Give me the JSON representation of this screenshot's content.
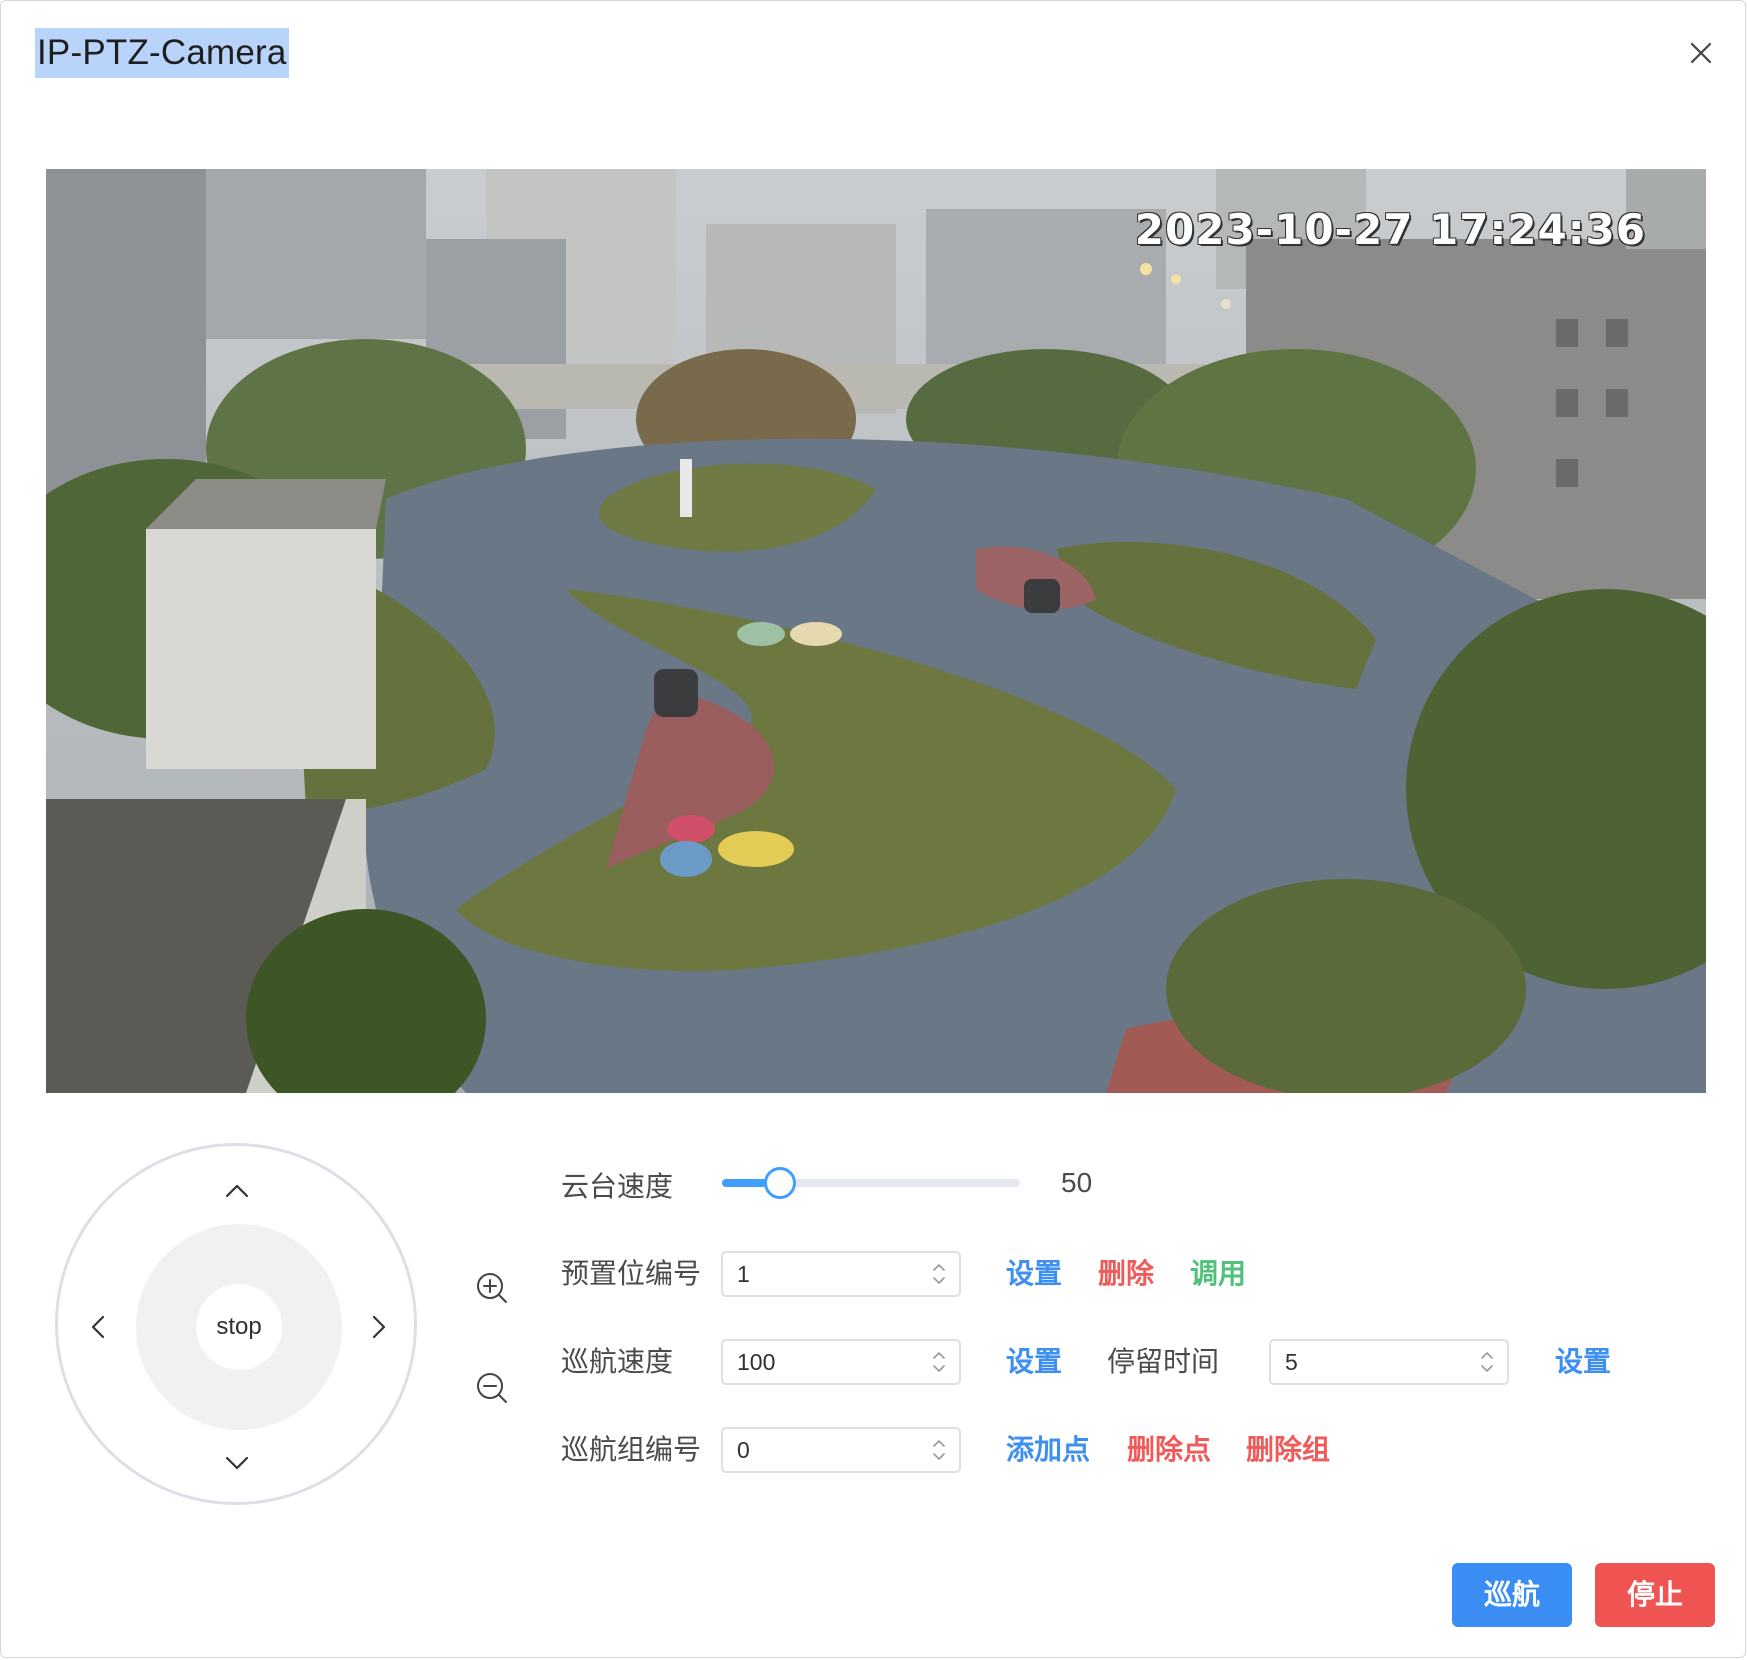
{
  "dialog": {
    "title": "IP-PTZ-Camera"
  },
  "video": {
    "timestamp": "2023-10-27 17:24:36"
  },
  "joystick": {
    "stop_label": "stop"
  },
  "controls": {
    "ptz_speed": {
      "label": "云台速度",
      "value": 50,
      "min": 0,
      "max": 100,
      "value_text": "50"
    },
    "preset": {
      "label": "预置位编号",
      "value": "1",
      "set_label": "设置",
      "delete_label": "删除",
      "call_label": "调用"
    },
    "cruise_speed": {
      "label": "巡航速度",
      "value": "100",
      "set_label": "设置"
    },
    "dwell_time": {
      "label": "停留时间",
      "value": "5",
      "set_label": "设置"
    },
    "cruise_group": {
      "label": "巡航组编号",
      "value": "0",
      "add_point_label": "添加点",
      "delete_point_label": "删除点",
      "delete_group_label": "删除组"
    }
  },
  "footer": {
    "cruise_button": "巡航",
    "stop_button": "停止"
  },
  "colors": {
    "primary": "#3a8df3",
    "danger": "#f05452",
    "success": "#50c17a",
    "slider": "#409eff"
  },
  "icons": {
    "close": "close-icon",
    "zoom_in": "zoom-in-icon",
    "zoom_out": "zoom-out-icon",
    "up": "chevron-up-icon",
    "down": "chevron-down-icon",
    "left": "chevron-left-icon",
    "right": "chevron-right-icon"
  }
}
